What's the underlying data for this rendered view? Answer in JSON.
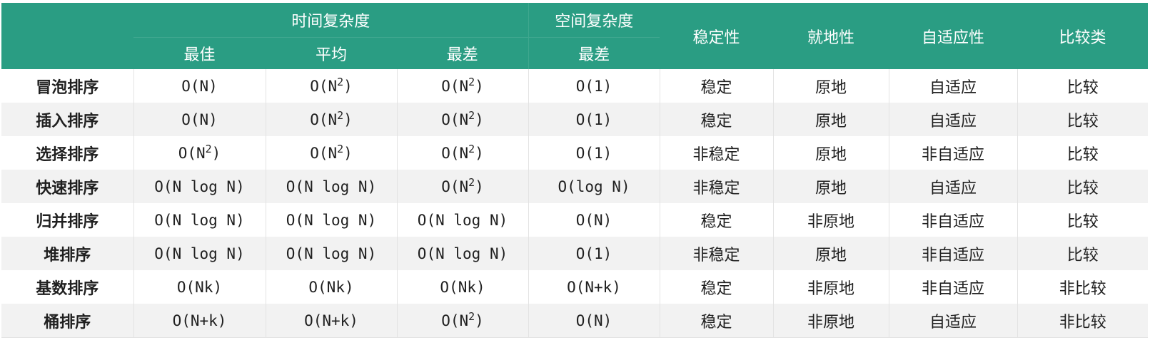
{
  "header": {
    "time_complexity": "时间复杂度",
    "space_complexity": "空间复杂度",
    "best": "最佳",
    "average": "平均",
    "worst": "最差",
    "space_worst": "最差",
    "stability": "稳定性",
    "in_place": "就地性",
    "adaptive": "自适应性",
    "comparison": "比较类"
  },
  "colors": {
    "header_bg": "#2a9d83",
    "header_text": "#ffffff",
    "stripe": "#f2f2f2"
  },
  "rows": [
    {
      "name": "冒泡排序",
      "best": {
        "base": "O(N)",
        "sup": ""
      },
      "avg": {
        "base": "O(N",
        "sup": "2"
      },
      "worst": {
        "base": "O(N",
        "sup": "2"
      },
      "space": {
        "base": "O(1)",
        "sup": ""
      },
      "stable": "稳定",
      "in_place": "原地",
      "adaptive": "自适应",
      "comparison": "比较"
    },
    {
      "name": "插入排序",
      "best": {
        "base": "O(N)",
        "sup": ""
      },
      "avg": {
        "base": "O(N",
        "sup": "2"
      },
      "worst": {
        "base": "O(N",
        "sup": "2"
      },
      "space": {
        "base": "O(1)",
        "sup": ""
      },
      "stable": "稳定",
      "in_place": "原地",
      "adaptive": "自适应",
      "comparison": "比较"
    },
    {
      "name": "选择排序",
      "best": {
        "base": "O(N",
        "sup": "2"
      },
      "avg": {
        "base": "O(N",
        "sup": "2"
      },
      "worst": {
        "base": "O(N",
        "sup": "2"
      },
      "space": {
        "base": "O(1)",
        "sup": ""
      },
      "stable": "非稳定",
      "in_place": "原地",
      "adaptive": "非自适应",
      "comparison": "比较"
    },
    {
      "name": "快速排序",
      "best": {
        "base": "O(N log N)",
        "sup": ""
      },
      "avg": {
        "base": "O(N log N)",
        "sup": ""
      },
      "worst": {
        "base": "O(N",
        "sup": "2"
      },
      "space": {
        "base": "O(log N)",
        "sup": ""
      },
      "stable": "非稳定",
      "in_place": "原地",
      "adaptive": "自适应",
      "comparison": "比较"
    },
    {
      "name": "归并排序",
      "best": {
        "base": "O(N log N)",
        "sup": ""
      },
      "avg": {
        "base": "O(N log N)",
        "sup": ""
      },
      "worst": {
        "base": "O(N log N)",
        "sup": ""
      },
      "space": {
        "base": "O(N)",
        "sup": ""
      },
      "stable": "稳定",
      "in_place": "非原地",
      "adaptive": "非自适应",
      "comparison": "比较"
    },
    {
      "name": "堆排序",
      "best": {
        "base": "O(N log N)",
        "sup": ""
      },
      "avg": {
        "base": "O(N log N)",
        "sup": ""
      },
      "worst": {
        "base": "O(N log N)",
        "sup": ""
      },
      "space": {
        "base": "O(1)",
        "sup": ""
      },
      "stable": "非稳定",
      "in_place": "原地",
      "adaptive": "非自适应",
      "comparison": "比较"
    },
    {
      "name": "基数排序",
      "best": {
        "base": "O(Nk)",
        "sup": ""
      },
      "avg": {
        "base": "O(Nk)",
        "sup": ""
      },
      "worst": {
        "base": "O(Nk)",
        "sup": ""
      },
      "space": {
        "base": "O(N+k)",
        "sup": ""
      },
      "stable": "稳定",
      "in_place": "非原地",
      "adaptive": "非自适应",
      "comparison": "非比较"
    },
    {
      "name": "桶排序",
      "best": {
        "base": "O(N+k)",
        "sup": ""
      },
      "avg": {
        "base": "O(N+k)",
        "sup": ""
      },
      "worst": {
        "base": "O(N",
        "sup": "2"
      },
      "space": {
        "base": "O(N)",
        "sup": ""
      },
      "stable": "稳定",
      "in_place": "非原地",
      "adaptive": "自适应",
      "comparison": "非比较"
    }
  ]
}
